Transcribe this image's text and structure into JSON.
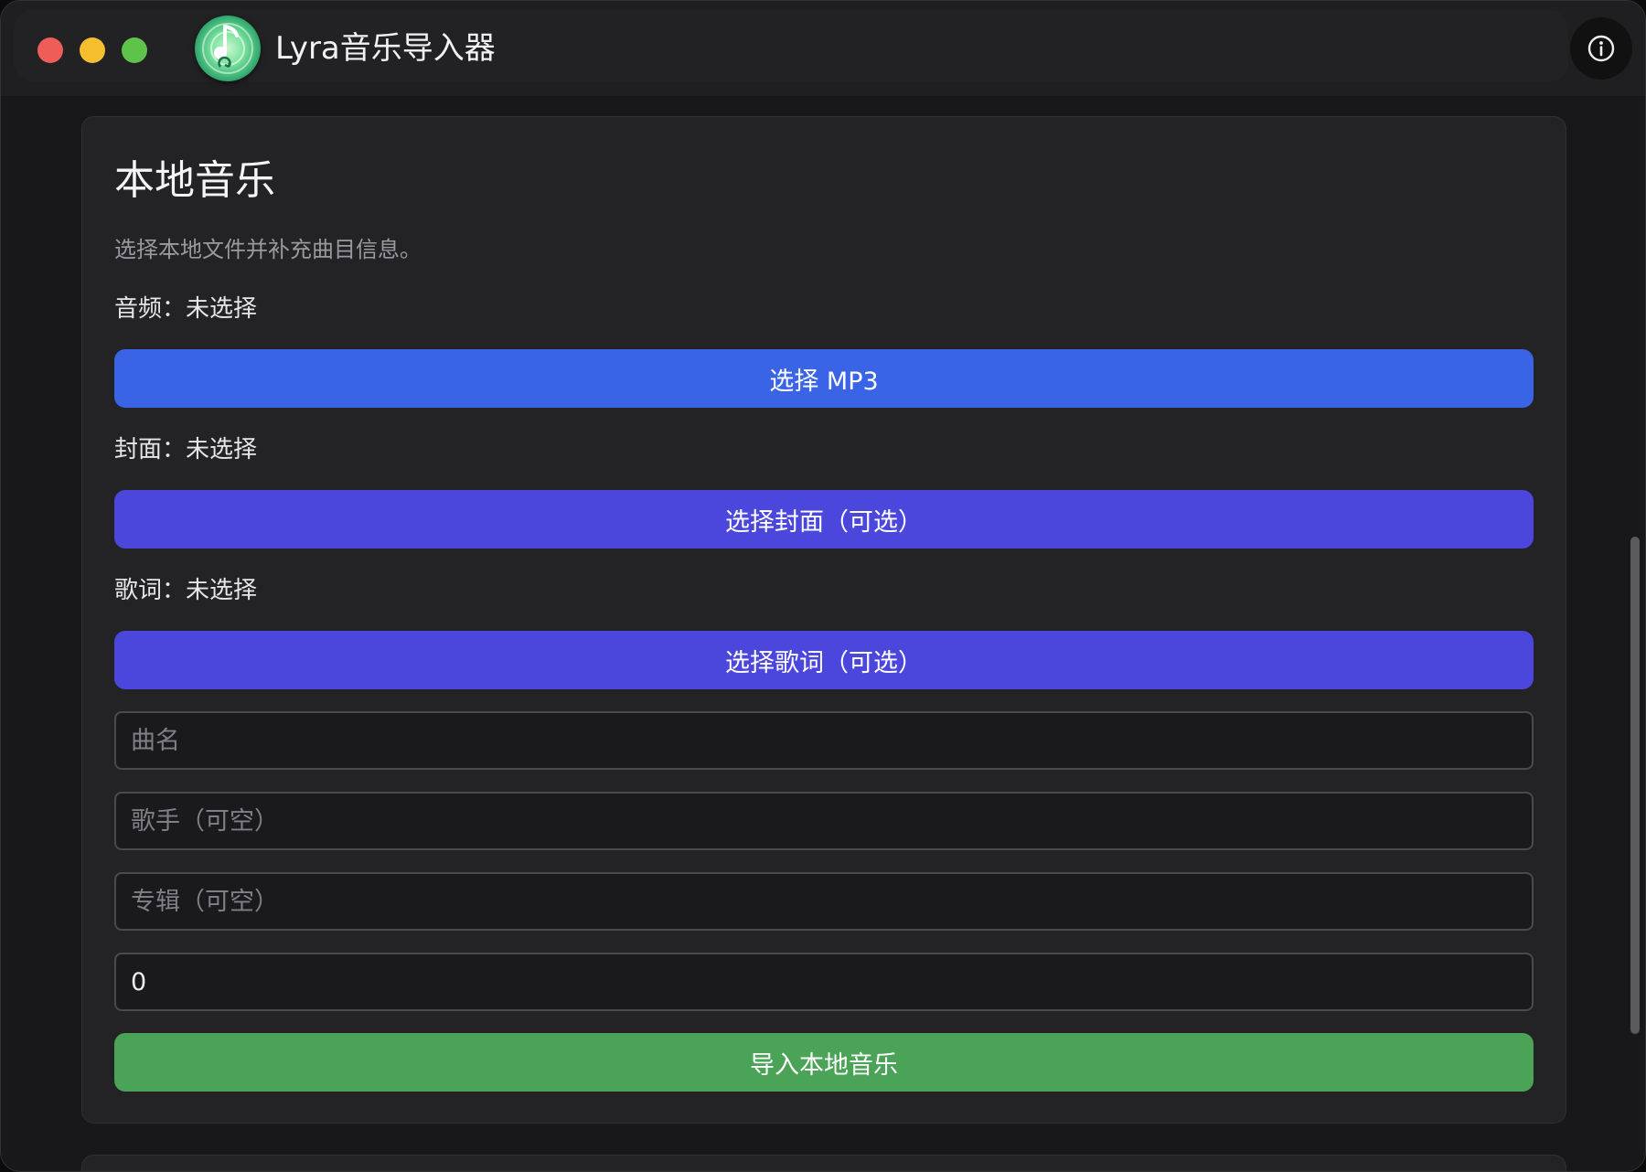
{
  "app": {
    "title": "Lyra音乐导入器",
    "logo_icon": "music-import-logo",
    "info_icon": "info-icon"
  },
  "local_music": {
    "title": "本地音乐",
    "subtitle": "选择本地文件并补充曲目信息。",
    "audio_status": "音频：未选择",
    "select_mp3_label": "选择 MP3",
    "cover_status": "封面：未选择",
    "select_cover_label": "选择封面（可选）",
    "lyrics_status": "歌词：未选择",
    "select_lyrics_label": "选择歌词（可选）",
    "song_name": {
      "placeholder": "曲名",
      "value": ""
    },
    "artist": {
      "placeholder": "歌手（可空）",
      "value": ""
    },
    "album": {
      "placeholder": "专辑（可空）",
      "value": ""
    },
    "number_value": "0",
    "import_label": "导入本地音乐"
  },
  "colors": {
    "window_bg": "#18181a",
    "card_bg": "#232325",
    "primary_blue": "#3a64e6",
    "indigo": "#4b47dc",
    "success_green": "#4aa356",
    "traffic_close": "#ee5d57",
    "traffic_minimize": "#f4be2e",
    "traffic_zoom": "#5ec34a"
  }
}
